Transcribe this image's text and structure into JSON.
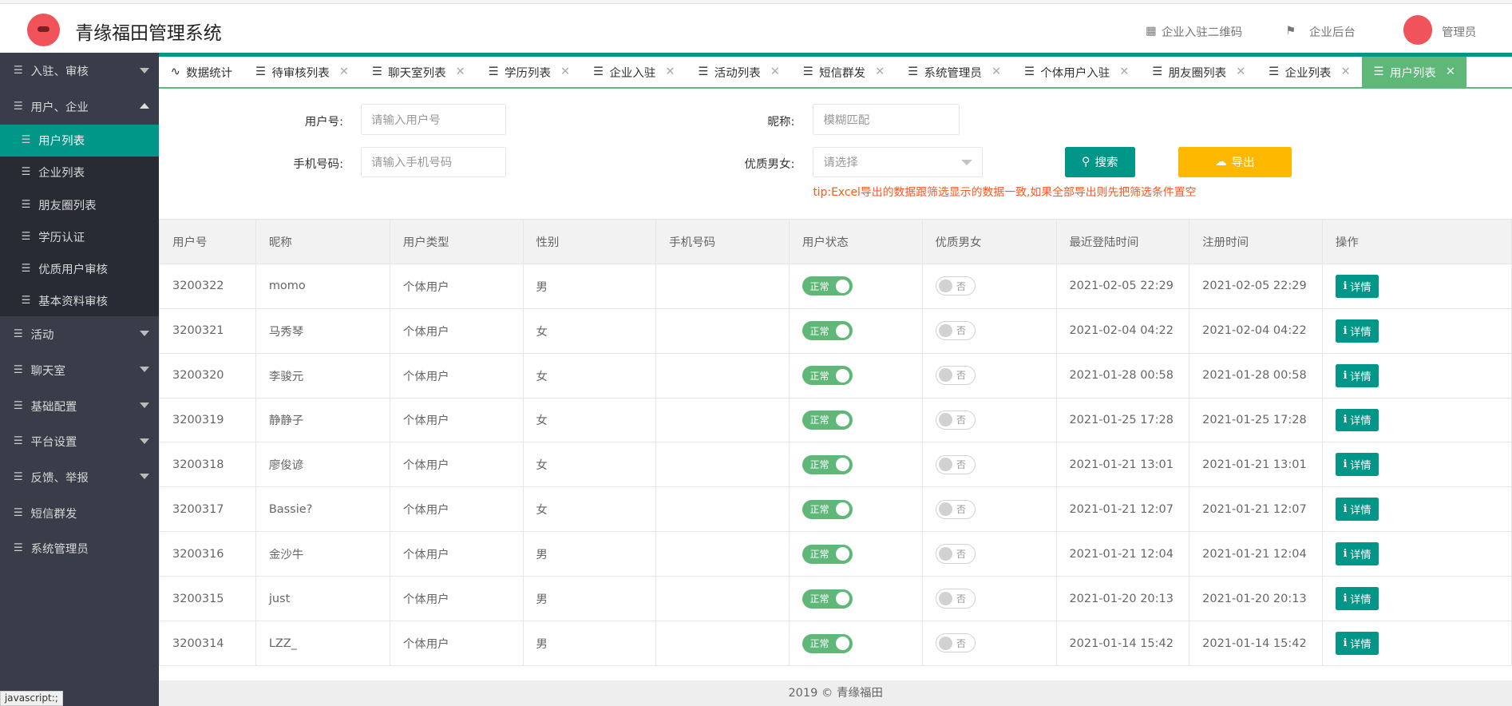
{
  "header": {
    "title": "青缘福田管理系统",
    "links": [
      {
        "icon": "qrcode-icon",
        "label": "企业入驻二维码"
      },
      {
        "icon": "flag-icon",
        "label": "企业后台"
      }
    ],
    "user": "管理员"
  },
  "sidebar": {
    "items": [
      {
        "label": "入驻、审核",
        "caret": "down"
      },
      {
        "label": "用户、企业",
        "caret": "up",
        "children": [
          {
            "label": "用户列表",
            "active": true
          },
          {
            "label": "企业列表"
          },
          {
            "label": "朋友圈列表"
          },
          {
            "label": "学历认证"
          },
          {
            "label": "优质用户审核"
          },
          {
            "label": "基本资料审核"
          }
        ]
      },
      {
        "label": "活动",
        "caret": "down"
      },
      {
        "label": "聊天室",
        "caret": "down"
      },
      {
        "label": "基础配置",
        "caret": "down"
      },
      {
        "label": "平台设置",
        "caret": "down"
      },
      {
        "label": "反馈、举报",
        "caret": "down"
      },
      {
        "label": "短信群发"
      },
      {
        "label": "系统管理员"
      }
    ]
  },
  "tabs": [
    {
      "label": "数据统计",
      "icon": "pulse-icon"
    },
    {
      "label": "待审核列表"
    },
    {
      "label": "聊天室列表"
    },
    {
      "label": "学历列表"
    },
    {
      "label": "企业入驻"
    },
    {
      "label": "活动列表"
    },
    {
      "label": "短信群发"
    },
    {
      "label": "系统管理员"
    },
    {
      "label": "个体用户入驻"
    },
    {
      "label": "朋友圈列表"
    },
    {
      "label": "企业列表"
    },
    {
      "label": "用户列表",
      "active": true
    }
  ],
  "filters": {
    "user_id_label": "用户号:",
    "user_id_placeholder": "请输入用户号",
    "nickname_label": "昵称:",
    "nickname_placeholder": "模糊匹配",
    "phone_label": "手机号码:",
    "phone_placeholder": "请输入手机号码",
    "quality_label": "优质男女:",
    "quality_placeholder": "请选择",
    "search_label": "搜索",
    "export_label": "导出",
    "tip": "tip:Excel导出的数据跟筛选显示的数据一致,如果全部导出则先把筛选条件置空"
  },
  "table": {
    "columns": [
      "用户号",
      "昵称",
      "用户类型",
      "性别",
      "手机号码",
      "用户状态",
      "优质男女",
      "最近登陆时间",
      "注册时间",
      "操作"
    ],
    "status_on": "正常",
    "quality_off": "否",
    "detail_label": "详情",
    "rows": [
      [
        "3200322",
        "momo",
        "个体用户",
        "男",
        "",
        "2021-02-05 22:29",
        "2021-02-05 22:29"
      ],
      [
        "3200321",
        "马秀琴",
        "个体用户",
        "女",
        "",
        "2021-02-04 04:22",
        "2021-02-04 04:22"
      ],
      [
        "3200320",
        "李骏元",
        "个体用户",
        "女",
        "",
        "2021-01-28 00:58",
        "2021-01-28 00:58"
      ],
      [
        "3200319",
        "静静子",
        "个体用户",
        "女",
        "",
        "2021-01-25 17:28",
        "2021-01-25 17:28"
      ],
      [
        "3200318",
        "廖俊谚",
        "个体用户",
        "女",
        "",
        "2021-01-21 13:01",
        "2021-01-21 13:01"
      ],
      [
        "3200317",
        "Bassie?",
        "个体用户",
        "女",
        "",
        "2021-01-21 12:07",
        "2021-01-21 12:07"
      ],
      [
        "3200316",
        "金沙牛",
        "个体用户",
        "男",
        "",
        "2021-01-21 12:04",
        "2021-01-21 12:04"
      ],
      [
        "3200315",
        "just",
        "个体用户",
        "男",
        "",
        "2021-01-20 20:13",
        "2021-01-20 20:13"
      ],
      [
        "3200314",
        "LZZ_",
        "个体用户",
        "男",
        "",
        "2021-01-14 15:42",
        "2021-01-14 15:42"
      ]
    ]
  },
  "footer": "2019 © 青缘福田",
  "statusbar": "javascript:;",
  "colors": {
    "teal": "#009688",
    "green": "#5fb878",
    "orange": "#ffb800",
    "sidebar": "#393D49",
    "tip": "#ff5722"
  }
}
